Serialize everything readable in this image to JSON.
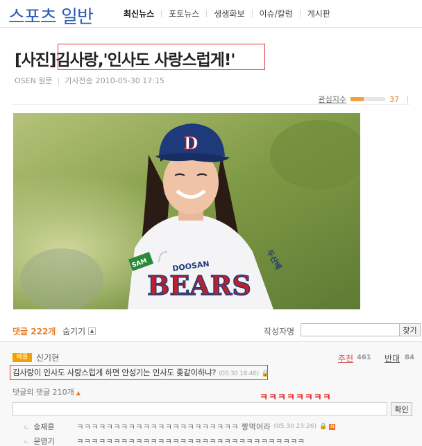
{
  "header": {
    "section_title": "스포츠 일반",
    "nav": [
      "최신뉴스",
      "포토뉴스",
      "생생화보",
      "이슈/칼럼",
      "게시판"
    ]
  },
  "article": {
    "headline": "[사진]김사랑,'인사도 사랑스럽게!'",
    "source": "OSEN 원문",
    "sent_label": "기사전송",
    "datetime": "2010-05-30 17:15",
    "interest_label": "관심지수",
    "interest_value": "37",
    "photo": {
      "cap_letter": "D",
      "jersey_brand": "DOOSAN",
      "jersey_team": "BEARS",
      "jersey_side": "두산베",
      "jersey_patch": "SAM"
    }
  },
  "comments": {
    "count_label": "댓글 222개",
    "hide_label": "숨기기",
    "author_label": "작성자명",
    "author_placeholder": "",
    "find_label": "찾기",
    "best": {
      "badge": "베플",
      "author": "신기현",
      "recommend_label": "추천",
      "recommend_count": "461",
      "oppose_label": "반대",
      "oppose_count": "84",
      "text": "김사랑이 인사도 사랑스럽게 하면 안성기는 인사도 좆같이하냐?",
      "time": "(05.30 18:46)"
    },
    "reply_count_label": "댓글의 댓글 210개",
    "annotation": "ㅋㅋㅋㅋㅋㅋㅋㅋ",
    "reply_placeholder": "",
    "confirm_label": "확인",
    "replies": [
      {
        "name": "송재훈",
        "text": "ㅋㅋㅋㅋㅋㅋㅋㅋㅋㅋㅋㅋㅋㅋㅋㅋㅋㅋㅋㅋㅋㅋ 짱먹어라",
        "time": "(05.30 23:26)"
      },
      {
        "name": "문영기",
        "text": "ㅋㅋㅋㅋㅋㅋㅋㅋㅋㅋㅋㅋㅋㅋㅋㅋㅋㅋㅋㅋㅋㅋㅋㅋㅋㅋㅋㅋㅋㅋㅋ",
        "time": ""
      }
    ]
  },
  "colors": {
    "brand_blue": "#2b5ab8",
    "accent_orange": "#e67e22",
    "highlight_red": "#d33333"
  }
}
